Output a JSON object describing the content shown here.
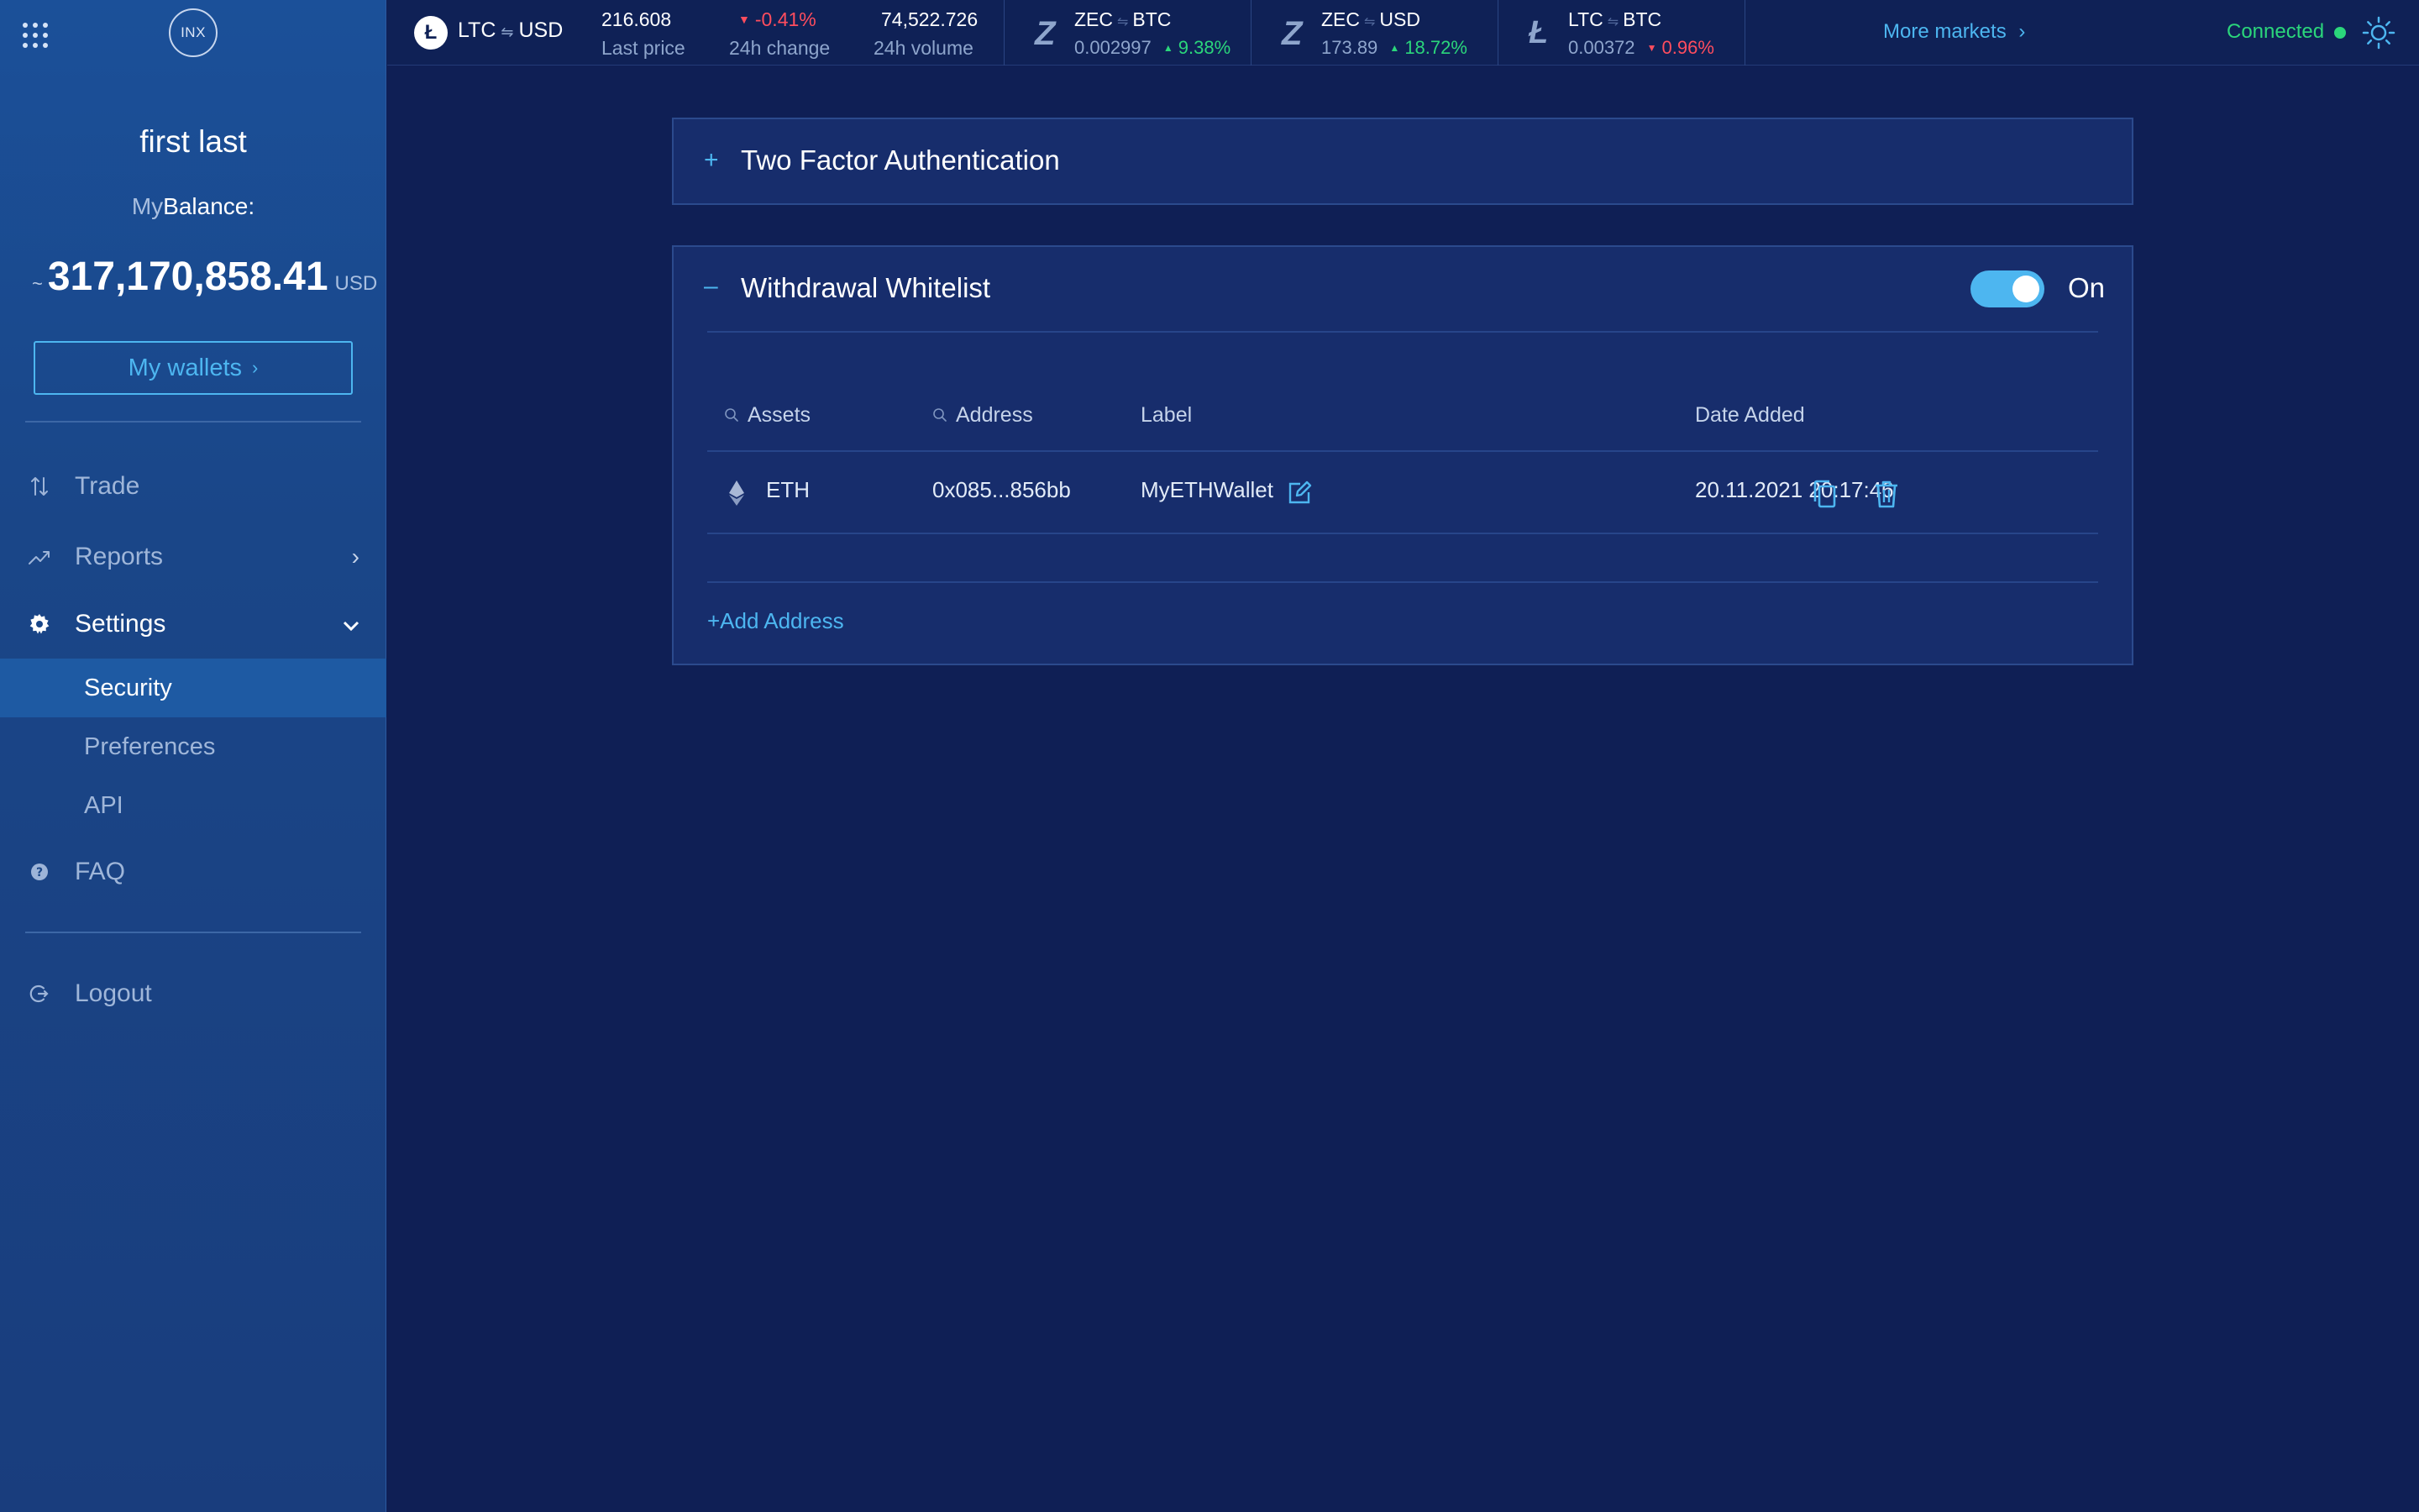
{
  "app": {
    "logo_text": "INX"
  },
  "sidebar": {
    "username": "first last",
    "balance_label_my": "My",
    "balance_label_balance": "Balance:",
    "balance_tilde": "~",
    "balance_amount": "317,170,858.41",
    "balance_currency": "USD",
    "wallets_button": "My wallets",
    "nav": {
      "trade": "Trade",
      "reports": "Reports",
      "settings": "Settings",
      "faq": "FAQ",
      "logout": "Logout"
    },
    "settings_sub": {
      "security": "Security",
      "preferences": "Preferences",
      "api": "API"
    },
    "active_sub_item": "Security"
  },
  "topbar": {
    "main": {
      "coin_symbol": "Ł",
      "base": "LTC",
      "quote": "USD",
      "last_price": "216.608",
      "last_price_label": "Last price",
      "change": "-0.41%",
      "change_label": "24h change",
      "volume": "74,522.726",
      "volume_label": "24h volume"
    },
    "mini_markets": [
      {
        "icon": "zec-icon",
        "glyph": "Z",
        "base": "ZEC",
        "quote": "BTC",
        "price": "0.002997",
        "change": "9.38%",
        "direction": "up"
      },
      {
        "icon": "zec-icon",
        "glyph": "Z",
        "base": "ZEC",
        "quote": "USD",
        "price": "173.89",
        "change": "18.72%",
        "direction": "up"
      },
      {
        "icon": "ltc-icon",
        "glyph": "Ł",
        "base": "LTC",
        "quote": "BTC",
        "price": "0.00372",
        "change": "0.96%",
        "direction": "down"
      }
    ],
    "more_markets": "More markets",
    "connection_status": "Connected"
  },
  "main": {
    "two_factor": {
      "toggle": "+",
      "title": "Two Factor Authentication",
      "expanded": false
    },
    "whitelist": {
      "toggle": "–",
      "title": "Withdrawal Whitelist",
      "switch_on": true,
      "switch_label": "On",
      "columns": {
        "assets": "Assets",
        "address": "Address",
        "label": "Label",
        "date_added": "Date Added"
      },
      "rows": [
        {
          "asset": "ETH",
          "address": "0x085...856bb",
          "label": "MyETHWallet",
          "date_added": "20.11.2021 20:17:46"
        }
      ],
      "add_address": "+Add Address"
    }
  },
  "colors": {
    "background": "#0f1f55",
    "sidebar": "#1a4688",
    "accent": "#4db6f0",
    "positive": "#2bd67b",
    "negative": "#ff4d5e",
    "panel": "#172d6c"
  }
}
